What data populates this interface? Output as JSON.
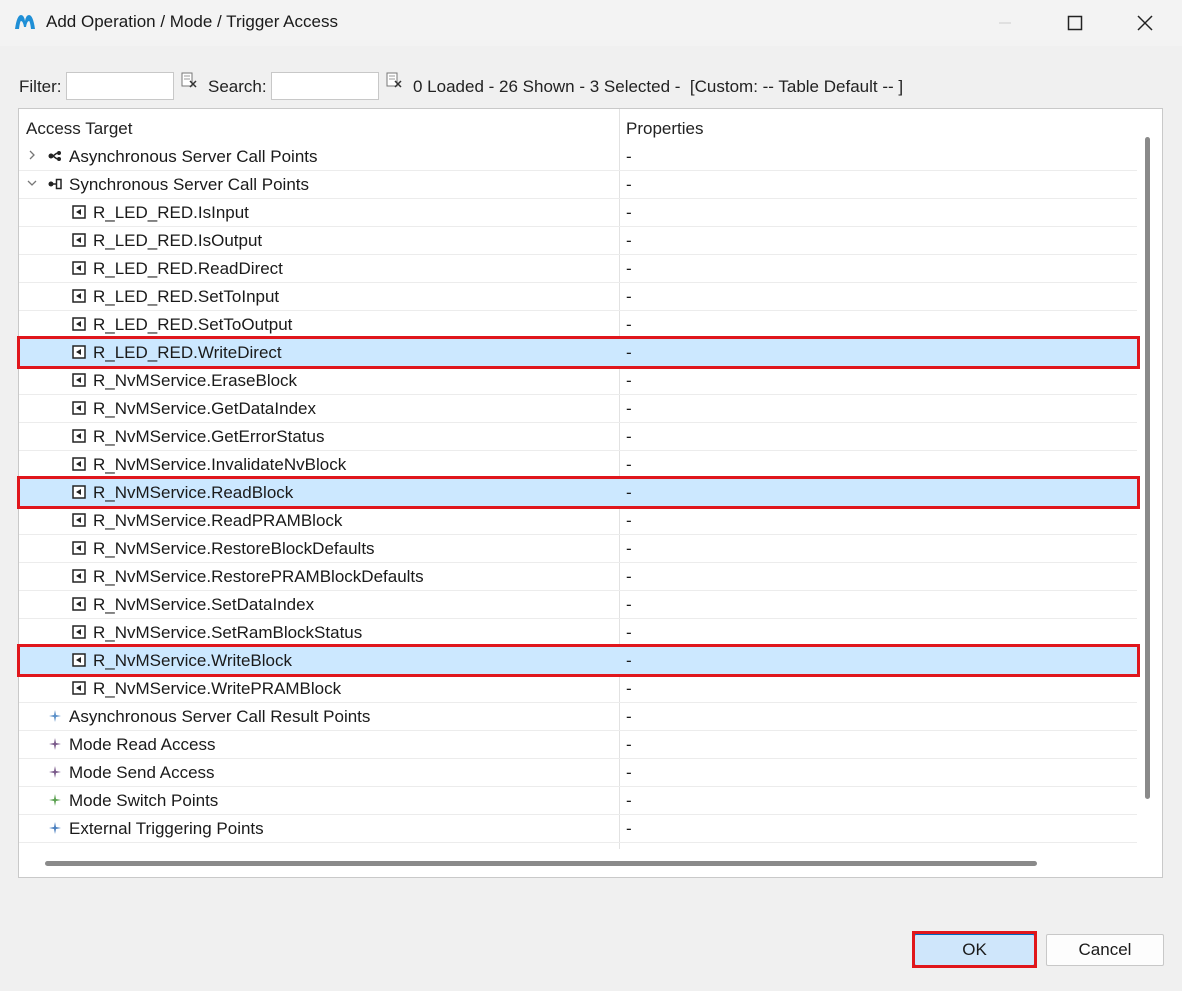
{
  "window": {
    "title": "Add Operation / Mode / Trigger Access"
  },
  "toolbar": {
    "filter_label": "Filter:",
    "filter_value": "",
    "search_label": "Search:",
    "search_value": "",
    "status": "0 Loaded - 26 Shown - 3 Selected -  [Custom: -- Table Default -- ]"
  },
  "table": {
    "headers": [
      "Access Target",
      "Properties"
    ],
    "rows": [
      {
        "label": "Asynchronous Server Call Points",
        "property": "-",
        "level": 0,
        "expander": "collapsed",
        "icon": "async-server-call-icon",
        "selected": false
      },
      {
        "label": "Synchronous Server Call Points",
        "property": "-",
        "level": 0,
        "expander": "expanded",
        "icon": "sync-server-call-icon",
        "selected": false
      },
      {
        "label": "R_LED_RED.IsInput",
        "property": "-",
        "level": 1,
        "icon": "operation-icon",
        "selected": false
      },
      {
        "label": "R_LED_RED.IsOutput",
        "property": "-",
        "level": 1,
        "icon": "operation-icon",
        "selected": false
      },
      {
        "label": "R_LED_RED.ReadDirect",
        "property": "-",
        "level": 1,
        "icon": "operation-icon",
        "selected": false
      },
      {
        "label": "R_LED_RED.SetToInput",
        "property": "-",
        "level": 1,
        "icon": "operation-icon",
        "selected": false
      },
      {
        "label": "R_LED_RED.SetToOutput",
        "property": "-",
        "level": 1,
        "icon": "operation-icon",
        "selected": false
      },
      {
        "label": "R_LED_RED.WriteDirect",
        "property": "-",
        "level": 1,
        "icon": "operation-icon",
        "selected": true
      },
      {
        "label": "R_NvMService.EraseBlock",
        "property": "-",
        "level": 1,
        "icon": "operation-icon",
        "selected": false
      },
      {
        "label": "R_NvMService.GetDataIndex",
        "property": "-",
        "level": 1,
        "icon": "operation-icon",
        "selected": false
      },
      {
        "label": "R_NvMService.GetErrorStatus",
        "property": "-",
        "level": 1,
        "icon": "operation-icon",
        "selected": false
      },
      {
        "label": "R_NvMService.InvalidateNvBlock",
        "property": "-",
        "level": 1,
        "icon": "operation-icon",
        "selected": false
      },
      {
        "label": "R_NvMService.ReadBlock",
        "property": "-",
        "level": 1,
        "icon": "operation-icon",
        "selected": true
      },
      {
        "label": "R_NvMService.ReadPRAMBlock",
        "property": "-",
        "level": 1,
        "icon": "operation-icon",
        "selected": false
      },
      {
        "label": "R_NvMService.RestoreBlockDefaults",
        "property": "-",
        "level": 1,
        "icon": "operation-icon",
        "selected": false
      },
      {
        "label": "R_NvMService.RestorePRAMBlockDefaults",
        "property": "-",
        "level": 1,
        "icon": "operation-icon",
        "selected": false
      },
      {
        "label": "R_NvMService.SetDataIndex",
        "property": "-",
        "level": 1,
        "icon": "operation-icon",
        "selected": false
      },
      {
        "label": "R_NvMService.SetRamBlockStatus",
        "property": "-",
        "level": 1,
        "icon": "operation-icon",
        "selected": false
      },
      {
        "label": "R_NvMService.WriteBlock",
        "property": "-",
        "level": 1,
        "icon": "operation-icon",
        "selected": true
      },
      {
        "label": "R_NvMService.WritePRAMBlock",
        "property": "-",
        "level": 1,
        "icon": "operation-icon",
        "selected": false
      },
      {
        "label": "Asynchronous Server Call Result Points",
        "property": "-",
        "level": 0,
        "icon": "sparkle-icon",
        "icon_color": "#5a8fc8",
        "selected": false
      },
      {
        "label": "Mode Read Access",
        "property": "-",
        "level": 0,
        "icon": "sparkle-icon",
        "icon_color": "#7a5a8a",
        "selected": false
      },
      {
        "label": "Mode Send Access",
        "property": "-",
        "level": 0,
        "icon": "sparkle-icon",
        "icon_color": "#7a5a8a",
        "selected": false
      },
      {
        "label": "Mode Switch Points",
        "property": "-",
        "level": 0,
        "icon": "sparkle-icon",
        "icon_color": "#5aa050",
        "selected": false
      },
      {
        "label": "External Triggering Points",
        "property": "-",
        "level": 0,
        "icon": "sparkle-icon",
        "icon_color": "#4a7fbf",
        "selected": false
      }
    ]
  },
  "buttons": {
    "ok": "OK",
    "cancel": "Cancel"
  },
  "colors": {
    "selection": "#cce8ff",
    "highlight": "#e0161c",
    "accent": "#0067c0"
  }
}
